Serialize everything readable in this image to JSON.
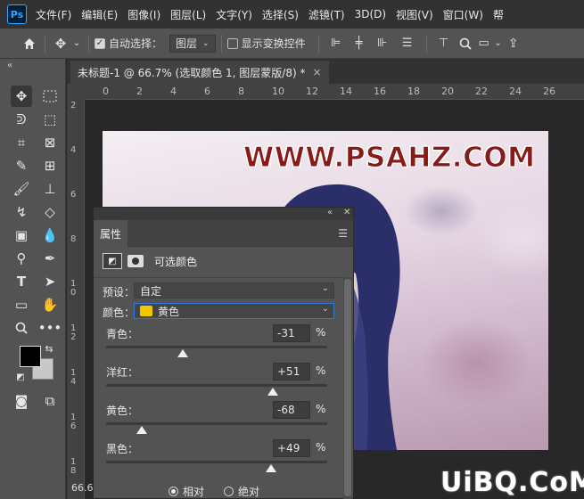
{
  "menubar": {
    "items": [
      "文件(F)",
      "编辑(E)",
      "图像(I)",
      "图层(L)",
      "文字(Y)",
      "选择(S)",
      "滤镜(T)",
      "3D(D)",
      "视图(V)",
      "窗口(W)",
      "帮"
    ]
  },
  "logo": "Ps",
  "options": {
    "auto_select_label": "自动选择：",
    "layer_dropdown": "图层",
    "show_transform_label": "显示变换控件"
  },
  "document": {
    "tab_title": "未标题-1 @ 66.7% (选取颜色 1, 图层蒙版/8) *",
    "tab_close": "×",
    "zoom": "66.6",
    "ruler_h": [
      "0",
      "2",
      "4",
      "6",
      "8",
      "10",
      "12",
      "14",
      "16",
      "18",
      "20",
      "22",
      "24",
      "26"
    ],
    "ruler_v": [
      "2",
      "4",
      "6",
      "8",
      "1\n0",
      "1\n2",
      "1\n4",
      "1\n6",
      "1\n8"
    ],
    "watermark": "WWW.PSAHZ.COM"
  },
  "properties": {
    "tab": "属性",
    "adjustment_title": "可选颜色",
    "preset_label": "预设：",
    "preset_value": "自定",
    "color_label": "颜色：",
    "color_value": "黄色",
    "color_swatch": "#f0c800",
    "sliders": [
      {
        "label": "青色：",
        "value": "-31",
        "level": -31
      },
      {
        "label": "洋红：",
        "value": "+51",
        "level": 51
      },
      {
        "label": "黄色：",
        "value": "-68",
        "level": -68
      },
      {
        "label": "黑色：",
        "value": "+49",
        "level": 49
      }
    ],
    "pct": "%",
    "mode_relative": "相对",
    "mode_absolute": "绝对"
  },
  "site_watermark": "UiBQ.CoM"
}
